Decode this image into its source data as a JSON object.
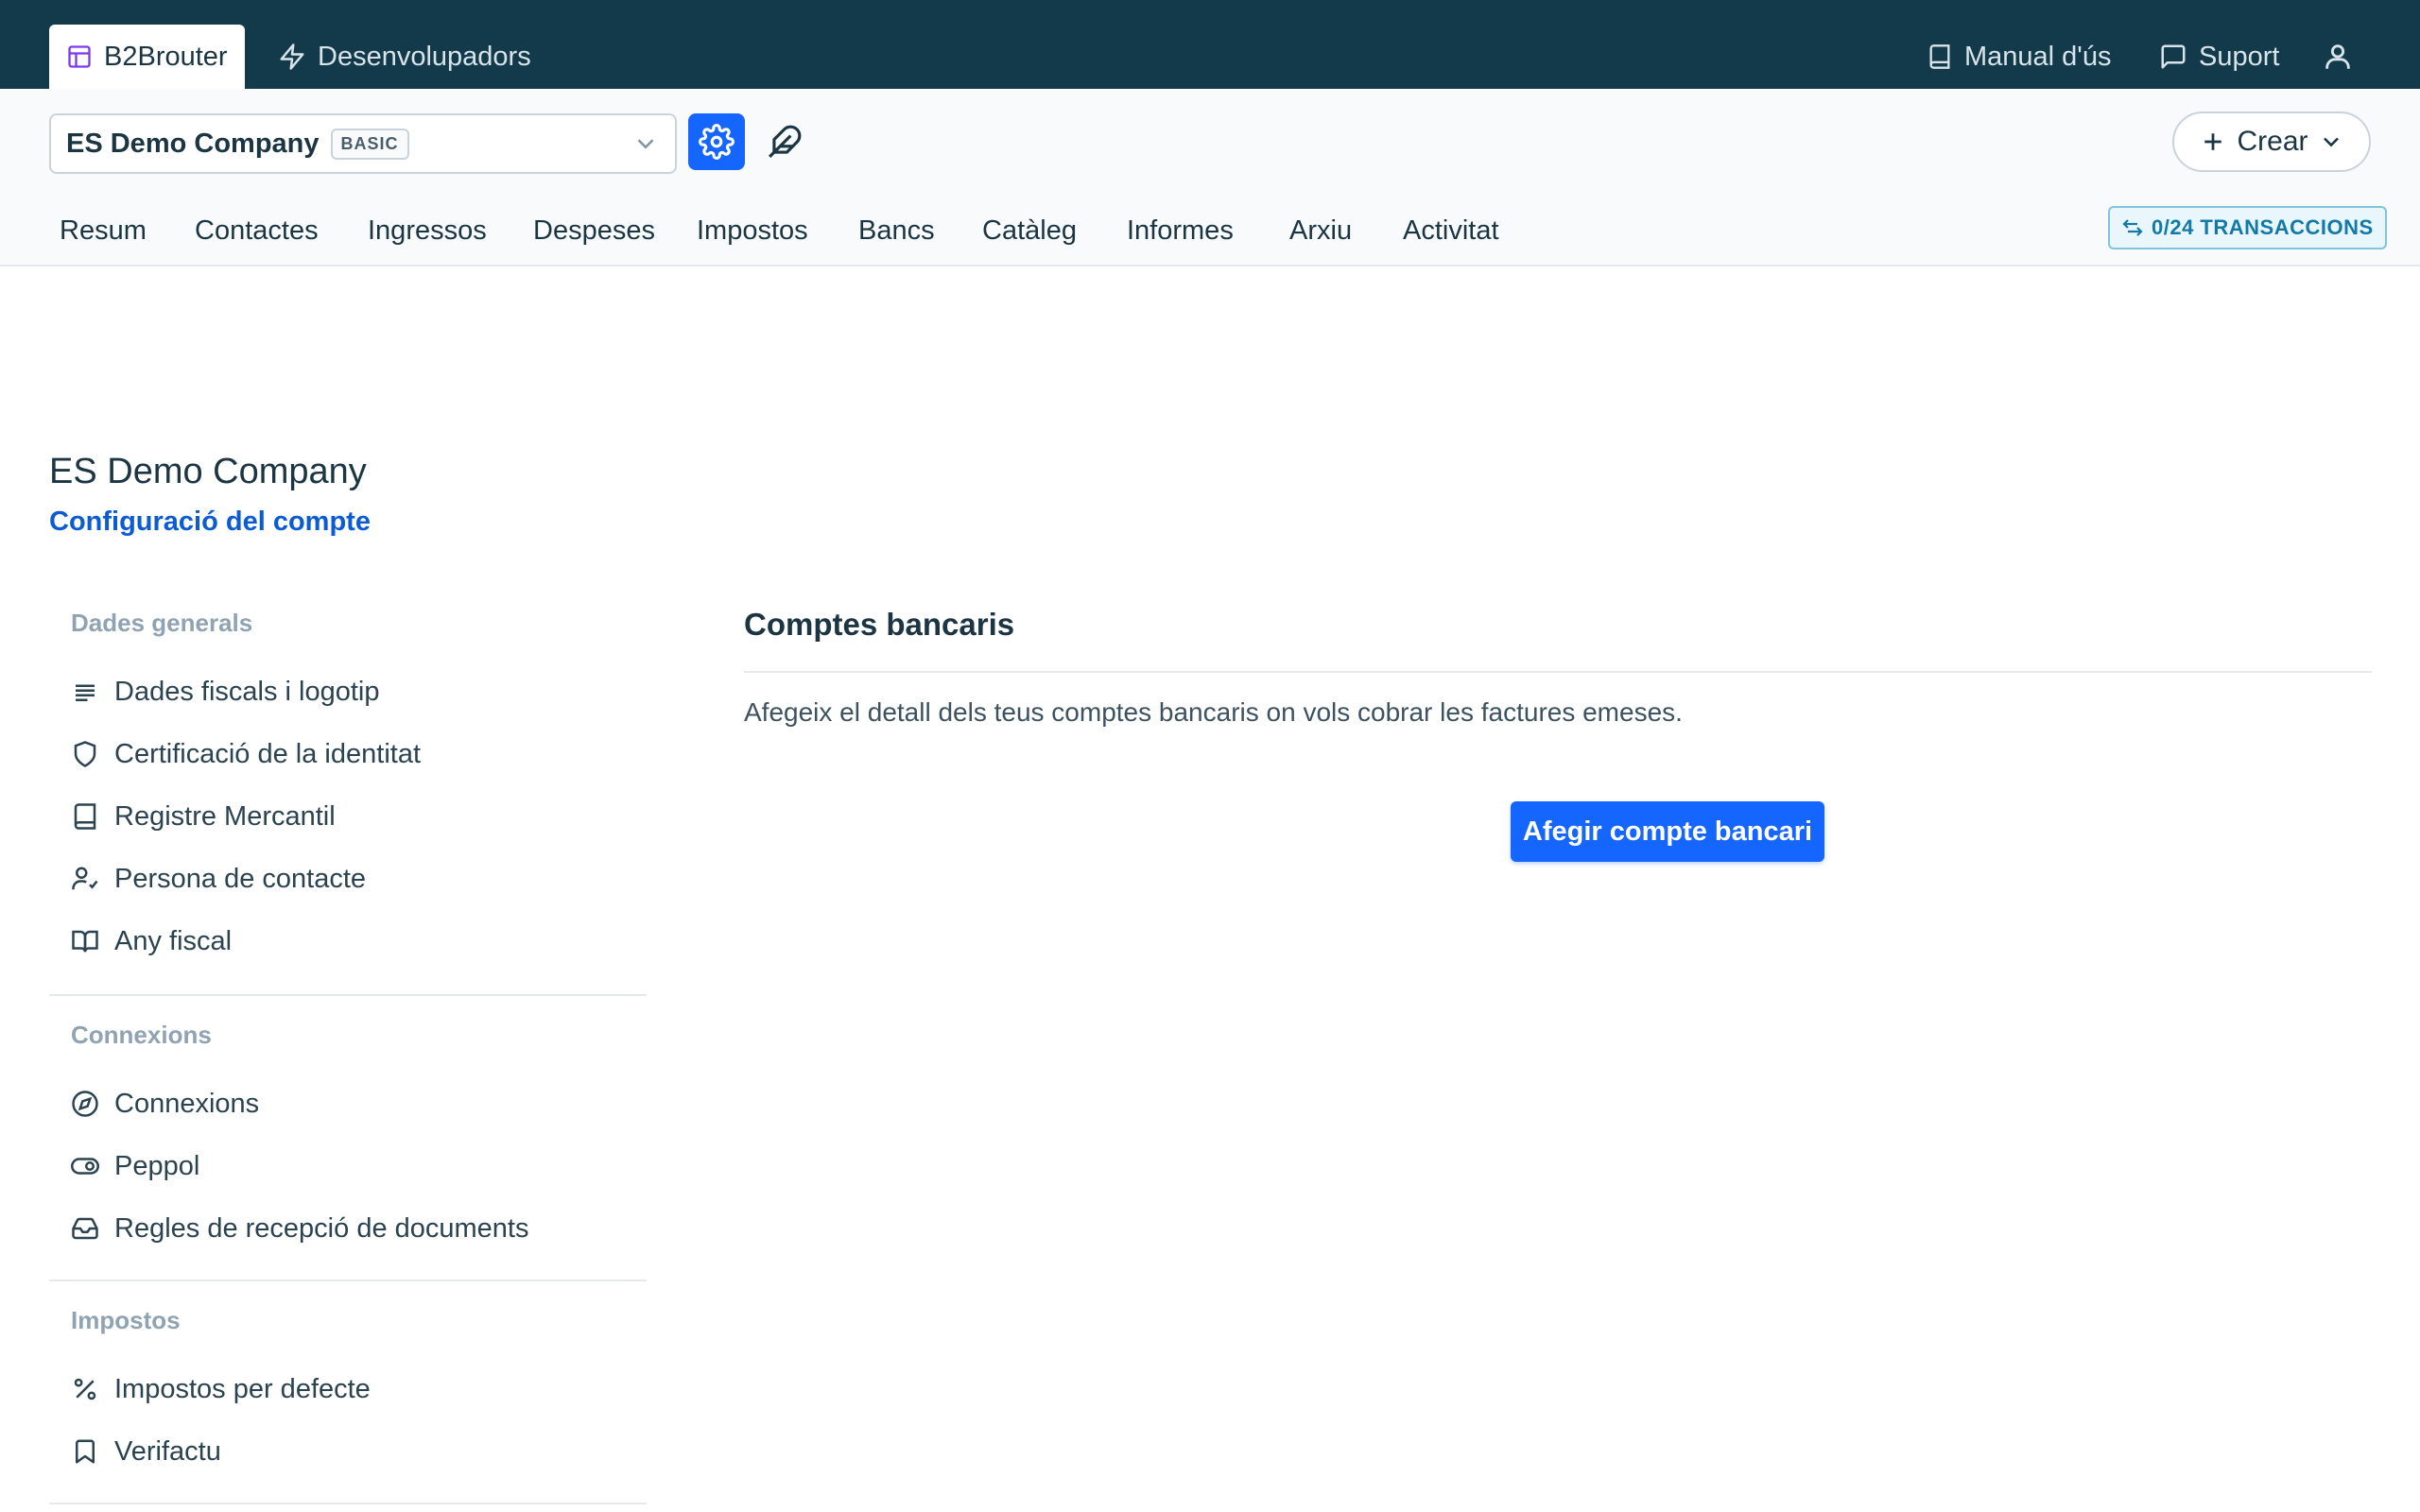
{
  "topbar": {
    "tabs": [
      {
        "label": "B2Brouter",
        "icon": "layout-icon",
        "active": true
      },
      {
        "label": "Desenvolupadors",
        "icon": "lightning-icon",
        "active": false
      }
    ],
    "right": {
      "manual_label": "Manual d'ús",
      "support_label": "Suport",
      "user_icon": "user-icon"
    }
  },
  "subbar": {
    "company_name": "ES Demo Company",
    "plan_badge": "BASIC",
    "create_label": "Crear",
    "nav": [
      "Resum",
      "Contactes",
      "Ingressos",
      "Despeses",
      "Impostos",
      "Bancs",
      "Catàleg",
      "Informes",
      "Arxiu",
      "Activitat"
    ],
    "transactions_badge": "0/24 TRANSACCIONS"
  },
  "page": {
    "title": "ES Demo Company",
    "subtitle": "Configuració del compte"
  },
  "sidebar": {
    "groups": [
      {
        "heading": "Dades generals",
        "items": [
          {
            "label": "Dades fiscals i logotip",
            "icon": "text-lines-icon"
          },
          {
            "label": "Certificació de la identitat",
            "icon": "shield-icon"
          },
          {
            "label": "Registre Mercantil",
            "icon": "book-icon"
          },
          {
            "label": "Persona de contacte",
            "icon": "user-check-icon"
          },
          {
            "label": "Any fiscal",
            "icon": "book-open-icon"
          }
        ]
      },
      {
        "heading": "Connexions",
        "items": [
          {
            "label": "Connexions",
            "icon": "compass-icon"
          },
          {
            "label": "Peppol",
            "icon": "toggle-icon"
          },
          {
            "label": "Regles de recepció de documents",
            "icon": "inbox-icon"
          }
        ]
      },
      {
        "heading": "Impostos",
        "items": [
          {
            "label": "Impostos per defecte",
            "icon": "percent-icon"
          },
          {
            "label": "Verifactu",
            "icon": "bookmark-icon"
          }
        ]
      }
    ]
  },
  "main": {
    "section_title": "Comptes bancaris",
    "description": "Afegeix el detall dels teus comptes bancaris on vols cobrar les factures emeses.",
    "add_button_label": "Afegir compte bancari"
  },
  "colors": {
    "topbar": "#123a4b",
    "accent": "#1565ff",
    "link": "#0b5bd3",
    "muted": "#8fa3b3"
  }
}
